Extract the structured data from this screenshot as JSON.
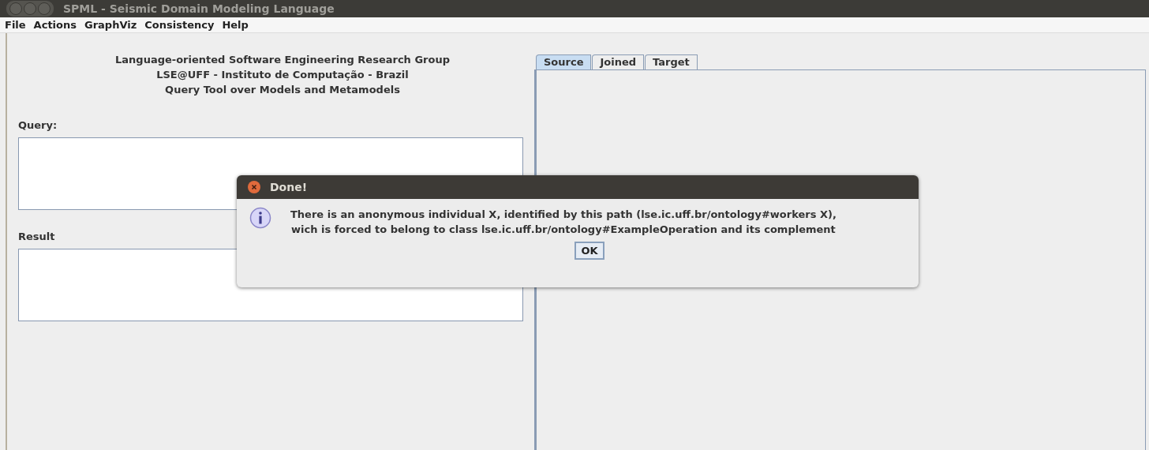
{
  "window": {
    "title": "SPML - Seismic Domain Modeling Language"
  },
  "menu": [
    "File",
    "Actions",
    "GraphViz",
    "Consistency",
    "Help"
  ],
  "header": [
    "Language-oriented Software Engineering Research Group",
    "LSE@UFF - Instituto de Computação - Brazil",
    "Query Tool over Models and Metamodels"
  ],
  "query": {
    "label": "Query:"
  },
  "result": {
    "label": "Result"
  },
  "tabs": [
    {
      "label": "Source",
      "selected": true
    },
    {
      "label": "Joined",
      "selected": false
    },
    {
      "label": "Target",
      "selected": false
    }
  ],
  "dialog": {
    "title": "Done!",
    "message": [
      "There is an anonymous individual X, identified by this path (lse.ic.uff.br/ontology#workers X),",
      "wich is forced to belong to class lse.ic.uff.br/ontology#ExampleOperation and its complement"
    ],
    "button": "OK"
  }
}
